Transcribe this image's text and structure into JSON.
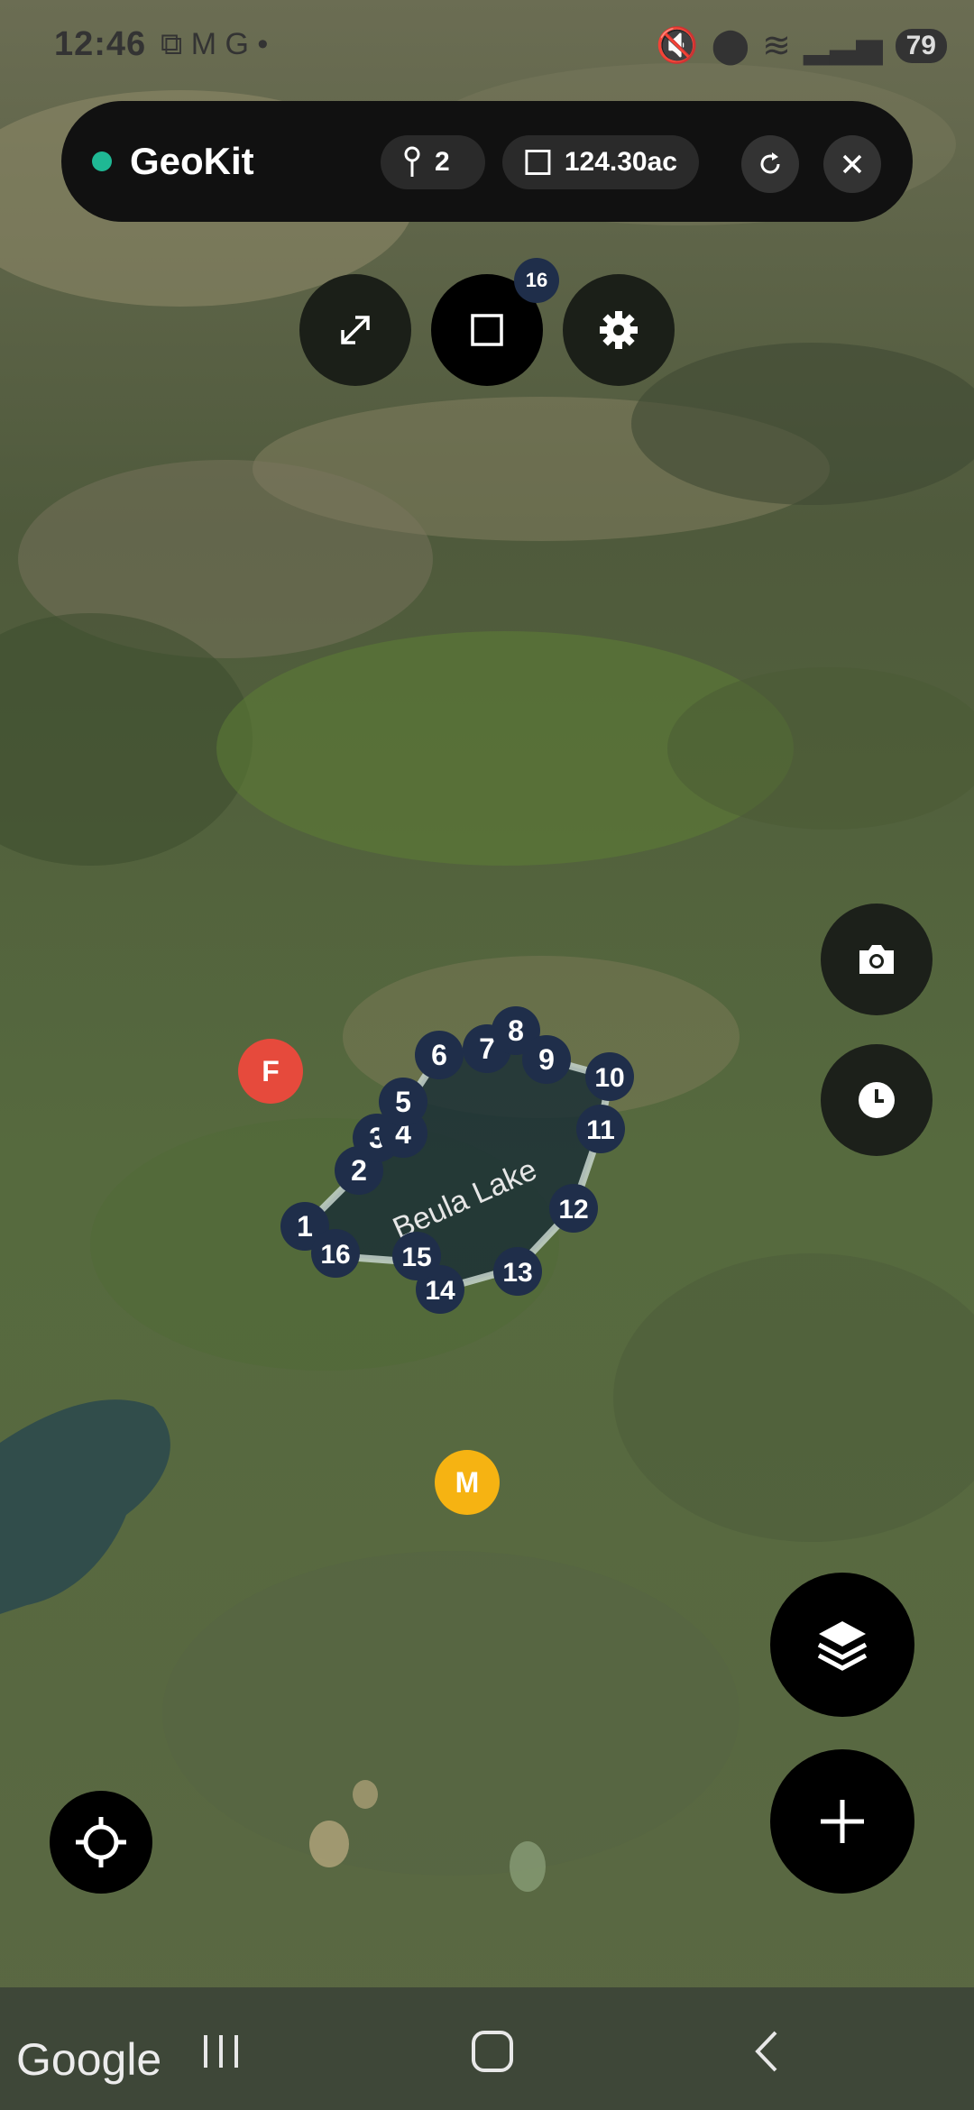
{
  "status_bar": {
    "time": "12:46",
    "left_icons": [
      "screenshot-icon",
      "gmail-icon",
      "google-icon",
      "dot-icon"
    ],
    "right_icons": [
      "mute-icon",
      "location-icon",
      "wifi-icon",
      "signal-icon"
    ],
    "battery": "79"
  },
  "topbar": {
    "title": "GeoKit",
    "points_count": "2",
    "area": "124.30ac",
    "refresh_icon": "refresh-icon",
    "close_icon": "close-icon"
  },
  "toolbar": {
    "expand_icon": "expand-icon",
    "shape_icon": "square-icon",
    "settings_icon": "gear-icon",
    "shape_badge": "16"
  },
  "map": {
    "lake_label": "Beula Lake",
    "vertex_labels": [
      "1",
      "2",
      "3",
      "4",
      "5",
      "6",
      "7",
      "8",
      "9",
      "10",
      "11",
      "12",
      "13",
      "14",
      "15",
      "16"
    ],
    "markers": [
      "F",
      "M"
    ]
  },
  "buttons": {
    "camera_icon": "camera-icon",
    "history_icon": "clock-icon",
    "layers_icon": "layers-icon",
    "add_icon": "plus-icon",
    "locate_icon": "crosshair-icon"
  },
  "navbar": {
    "google_logo": "Google",
    "recent": "recent-apps-icon",
    "home": "home-icon",
    "back": "back-icon"
  },
  "colors": {
    "topbar_bg": "#111111",
    "status_dot": "#1fb894",
    "vertex_fill": "#1f2e4a",
    "marker_f": "#e64a3c",
    "marker_m": "#f6b312",
    "lake_outline": "#b8c8c0"
  }
}
